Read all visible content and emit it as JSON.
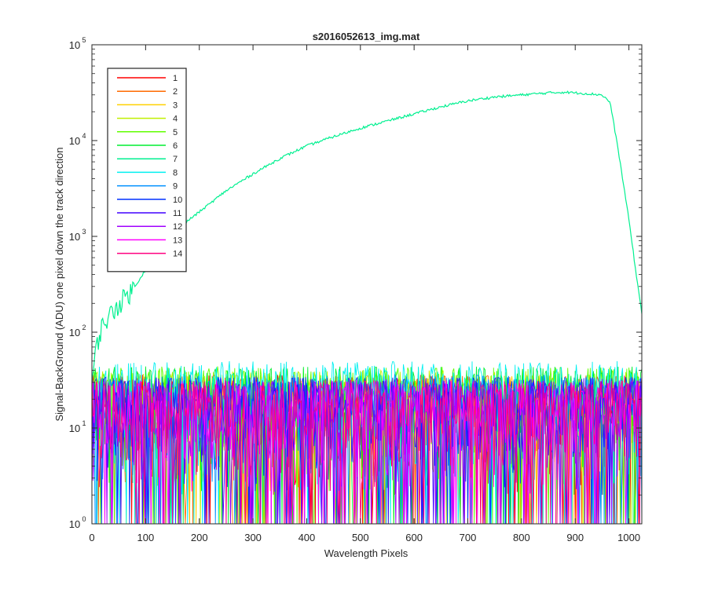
{
  "chart_data": {
    "type": "line",
    "title": "s2016052613_img.mat",
    "xlabel": "Wavelength Pixels",
    "ylabel": "Signal-BackGround (ADU) one pixel down the track direction",
    "xlim": [
      0,
      1024
    ],
    "ylim": [
      1,
      100000
    ],
    "yscale": "log",
    "grid": false,
    "legend_location": "top-left",
    "x_ticks": [
      "0",
      "100",
      "200",
      "300",
      "400",
      "500",
      "600",
      "700",
      "800",
      "900",
      "1000"
    ],
    "y_tick_exponents": [
      "0",
      "1",
      "2",
      "3",
      "4",
      "5"
    ],
    "series": [
      {
        "name": "1",
        "color": "#ff0000",
        "noise_mean": 18,
        "noise_max": 55
      },
      {
        "name": "2",
        "color": "#ff6a00",
        "noise_mean": 18,
        "noise_max": 55
      },
      {
        "name": "3",
        "color": "#ffd000",
        "noise_mean": 18,
        "noise_max": 60
      },
      {
        "name": "4",
        "color": "#c0f000",
        "noise_mean": 20,
        "noise_max": 65
      },
      {
        "name": "5",
        "color": "#60ff00",
        "noise_mean": 22,
        "noise_max": 75
      },
      {
        "name": "6",
        "color": "#00ee30",
        "noise_mean": 22,
        "noise_max": 75
      },
      {
        "name": "7",
        "color": "#00f090",
        "profile": [
          [
            0,
            30
          ],
          [
            10,
            80
          ],
          [
            20,
            120
          ],
          [
            50,
            200
          ],
          [
            80,
            300
          ],
          [
            100,
            450
          ],
          [
            120,
            700
          ],
          [
            150,
            1100
          ],
          [
            200,
            1800
          ],
          [
            250,
            3000
          ],
          [
            300,
            4500
          ],
          [
            350,
            6500
          ],
          [
            400,
            8800
          ],
          [
            450,
            11000
          ],
          [
            500,
            13500
          ],
          [
            550,
            16000
          ],
          [
            600,
            19000
          ],
          [
            650,
            22500
          ],
          [
            700,
            26000
          ],
          [
            750,
            28500
          ],
          [
            800,
            30000
          ],
          [
            850,
            31500
          ],
          [
            880,
            32000
          ],
          [
            920,
            31000
          ],
          [
            950,
            30000
          ],
          [
            965,
            25000
          ],
          [
            980,
            8000
          ],
          [
            1000,
            1500
          ],
          [
            1015,
            350
          ],
          [
            1024,
            160
          ]
        ]
      },
      {
        "name": "8",
        "color": "#00f0f0",
        "noise_mean": 25,
        "noise_max": 95
      },
      {
        "name": "9",
        "color": "#0090ff",
        "noise_mean": 18,
        "noise_max": 55
      },
      {
        "name": "10",
        "color": "#0030ff",
        "noise_mean": 17,
        "noise_max": 50
      },
      {
        "name": "11",
        "color": "#4000ff",
        "noise_mean": 17,
        "noise_max": 50
      },
      {
        "name": "12",
        "color": "#a000ff",
        "noise_mean": 16,
        "noise_max": 50
      },
      {
        "name": "13",
        "color": "#ff00ff",
        "noise_mean": 16,
        "noise_max": 50
      },
      {
        "name": "14",
        "color": "#ff0080",
        "noise_mean": 16,
        "noise_max": 50
      }
    ]
  }
}
